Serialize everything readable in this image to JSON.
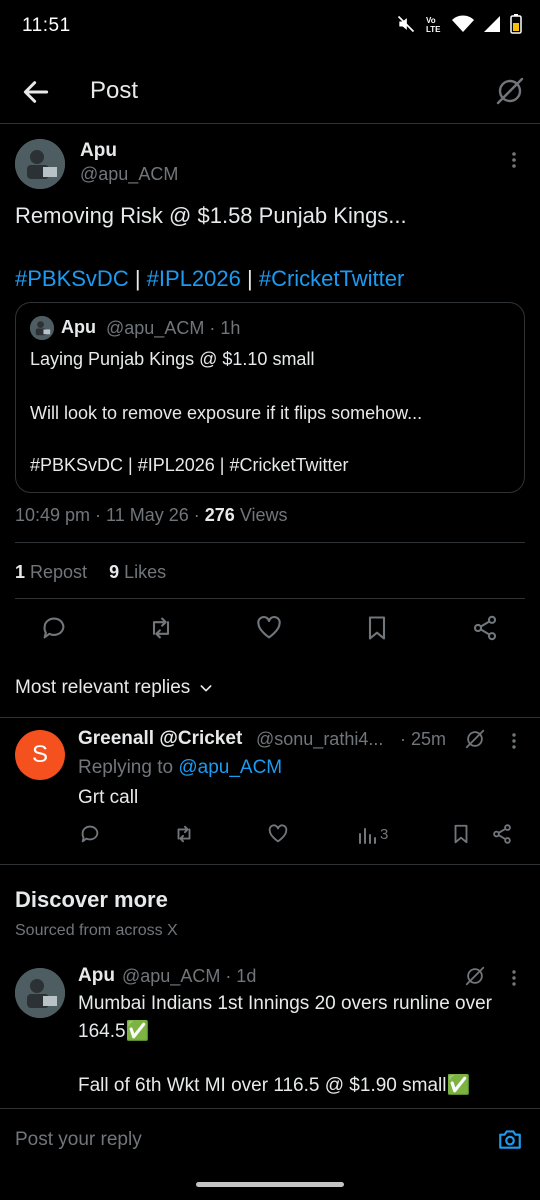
{
  "status_bar": {
    "time": "11:51",
    "icons": [
      "mute-icon",
      "volte-icon",
      "wifi-icon",
      "signal-icon",
      "battery-icon"
    ]
  },
  "header": {
    "title": "Post",
    "back_icon": "arrow-left-icon",
    "grok_icon": "grok-icon"
  },
  "post": {
    "author_name": "Apu",
    "author_handle": "@apu_ACM",
    "text": "Removing Risk @ $1.58 Punjab Kings...",
    "tags": [
      "#PBKSvDC",
      "#IPL2026",
      "#CricketTwitter"
    ],
    "tag_separator": " | ",
    "quoted": {
      "author_name": "Apu",
      "author_handle": "@apu_ACM",
      "time_ago": "· 1h",
      "lines": [
        "Laying Punjab Kings @ $1.10 small",
        "Will look to remove exposure if it flips somehow...",
        "#PBKSvDC | #IPL2026 | #CricketTwitter"
      ]
    },
    "timestamp": "10:49 pm · 11 May 26 · ",
    "views_count": "276",
    "views_label": " Views",
    "repost_count": "1",
    "repost_label": " Repost",
    "likes_count": "9",
    "likes_label": " Likes",
    "actions": [
      "reply-icon",
      "repost-icon",
      "like-icon",
      "bookmark-icon",
      "share-icon"
    ]
  },
  "replies_filter": {
    "label": "Most relevant replies"
  },
  "reply": {
    "avatar_letter": "S",
    "avatar_color": "#f4511e",
    "author_name": "Greenall @Cricket",
    "author_handle": "@sonu_rathi4...",
    "time_ago": "· 25m",
    "replying_label": "Replying to ",
    "replying_handle": "@apu_ACM",
    "text": "Grt call",
    "views": "3"
  },
  "discover": {
    "title": "Discover more",
    "subtitle": "Sourced from across X",
    "post": {
      "author_name": "Apu",
      "author_handle": "@apu_ACM · 1d",
      "lines": [
        "Mumbai Indians 1st Innings 20 overs runline over",
        "164.5✅",
        "Fall of 6th Wkt MI over 116.5 @ $1.90 small✅"
      ]
    }
  },
  "compose": {
    "placeholder": "Post your reply"
  },
  "colors": {
    "background": "#000000",
    "text": "#e7e9ea",
    "muted": "#71767b",
    "accent": "#1d9bf0",
    "border": "#2f3336"
  }
}
